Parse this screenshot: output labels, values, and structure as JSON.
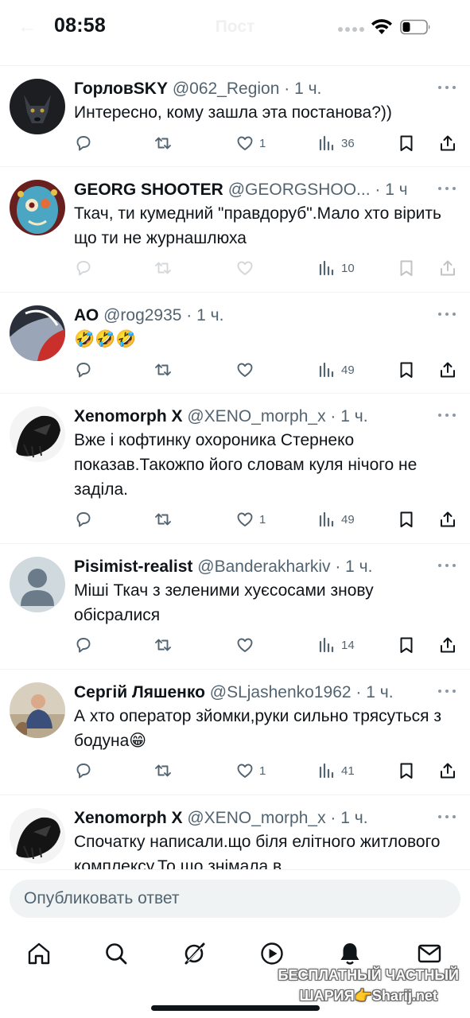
{
  "status_bar": {
    "time": "08:58"
  },
  "header": {
    "title": "Пост"
  },
  "tweets": [
    {
      "name": "ГорловSKY",
      "handle": "@062_Region",
      "dot": "·",
      "time": "1 ч.",
      "text": "Интересно, кому зашла эта постанова?))",
      "likes": "1",
      "views": "36",
      "faded": false
    },
    {
      "name": "GEORG SHOOTER",
      "handle": "@GEORGSHOO...",
      "dot": "·",
      "time": "1 ч.",
      "text": "Ткач, ти кумедний \"правдоруб\".Мало хто вірить що ти не журнашлюха",
      "likes": "",
      "views": "10",
      "faded": true
    },
    {
      "name": "АО",
      "handle": "@rog2935",
      "dot": "·",
      "time": "1 ч.",
      "text": "🤣🤣🤣",
      "likes": "",
      "views": "49",
      "faded": false
    },
    {
      "name": "Xenomorph X",
      "handle": "@XENO_morph_x",
      "dot": "·",
      "time": "1 ч.",
      "text": "Вже і кофтинку охороника Стернеко показав.Такожпо його словам куля нічого не заділа.",
      "likes": "1",
      "views": "49",
      "faded": false
    },
    {
      "name": "Pisimist-realist",
      "handle": "@Banderakharkiv",
      "dot": "·",
      "time": "1 ч.",
      "text": "Міші Ткач з зеленими хуєсосами знову обісралися",
      "likes": "",
      "views": "14",
      "faded": false
    },
    {
      "name": "Сергій Ляшенко",
      "handle": "@SLjashenko1962",
      "dot": "·",
      "time": "1 ч.",
      "text": "А хто оператор зйомки,руки сильно трясуться з бодуна😁",
      "likes": "1",
      "views": "41",
      "faded": false
    },
    {
      "name": "Xenomorph X",
      "handle": "@XENO_morph_x",
      "dot": "·",
      "time": "1 ч.",
      "text": "Спочатку написали.що біля елітного житлового комплексу.То що знімала в",
      "likes": "",
      "views": "",
      "faded": false
    }
  ],
  "reply": {
    "placeholder": "Опубликовать ответ"
  },
  "tab_bar": {
    "items": [
      "home-icon",
      "search-icon",
      "grok-icon",
      "video-icon",
      "notifications-icon",
      "messages-icon"
    ]
  },
  "watermark": {
    "line1": "БЕСПЛАТНЫЙ ЧАСТНЫЙ",
    "line2": "ШАРИЯ👉Sharij.net"
  },
  "colors": {
    "text": "#0f1419",
    "secondary": "#536471",
    "divider": "#eff3f4",
    "input_bg": "#eff3f4"
  }
}
